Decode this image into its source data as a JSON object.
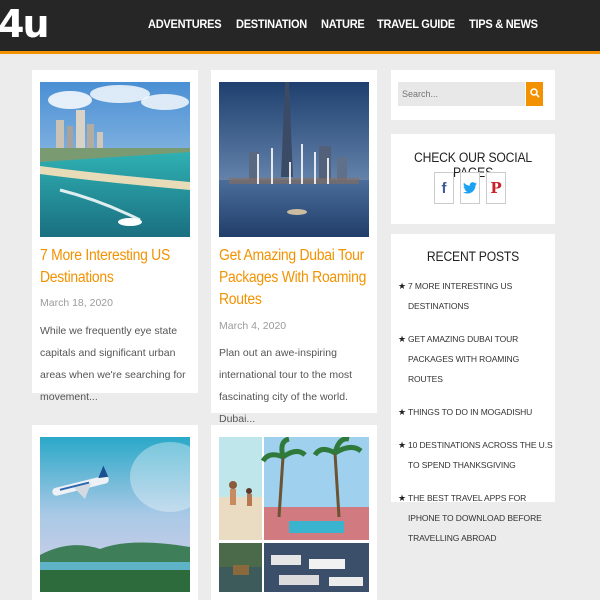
{
  "site": {
    "logo_text": "4u"
  },
  "nav": [
    "ADVENTURES",
    "DESTINATION",
    "NATURE",
    "TRAVEL GUIDE",
    "TIPS & NEWS"
  ],
  "posts": [
    {
      "title": "7 More Interesting US Destinations",
      "date": "March 18, 2020",
      "excerpt": "While we frequently eye state capitals and significant urban areas when we're searching for movement..."
    },
    {
      "title": "Get Amazing Dubai Tour Packages With Roaming Routes",
      "date": "March 4, 2020",
      "excerpt": "Plan out an awe-inspiring international tour to the most fascinating city of the world. Dubai..."
    },
    {
      "title": "",
      "date": "",
      "excerpt": ""
    },
    {
      "title": "",
      "date": "",
      "excerpt": ""
    }
  ],
  "sidebar": {
    "search": {
      "placeholder": "Search..."
    },
    "social": {
      "title": "CHECK OUR SOCIAL PAGES",
      "icons": [
        "facebook-icon",
        "twitter-icon",
        "pinterest-icon"
      ]
    },
    "recent": {
      "title": "RECENT POSTS",
      "items": [
        "7 MORE INTERESTING US DESTINATIONS",
        "GET AMAZING DUBAI TOUR PACKAGES WITH ROAMING ROUTES",
        "THINGS TO DO IN MOGADISHU",
        "10 DESTINATIONS ACROSS THE U.S TO SPEND THANKSGIVING",
        "THE BEST TRAVEL APPS FOR IPHONE TO DOWNLOAD BEFORE TRAVELLING ABROAD"
      ]
    }
  },
  "colors": {
    "accent": "#f39200",
    "header_bg": "#262626",
    "page_bg": "#ececec"
  }
}
